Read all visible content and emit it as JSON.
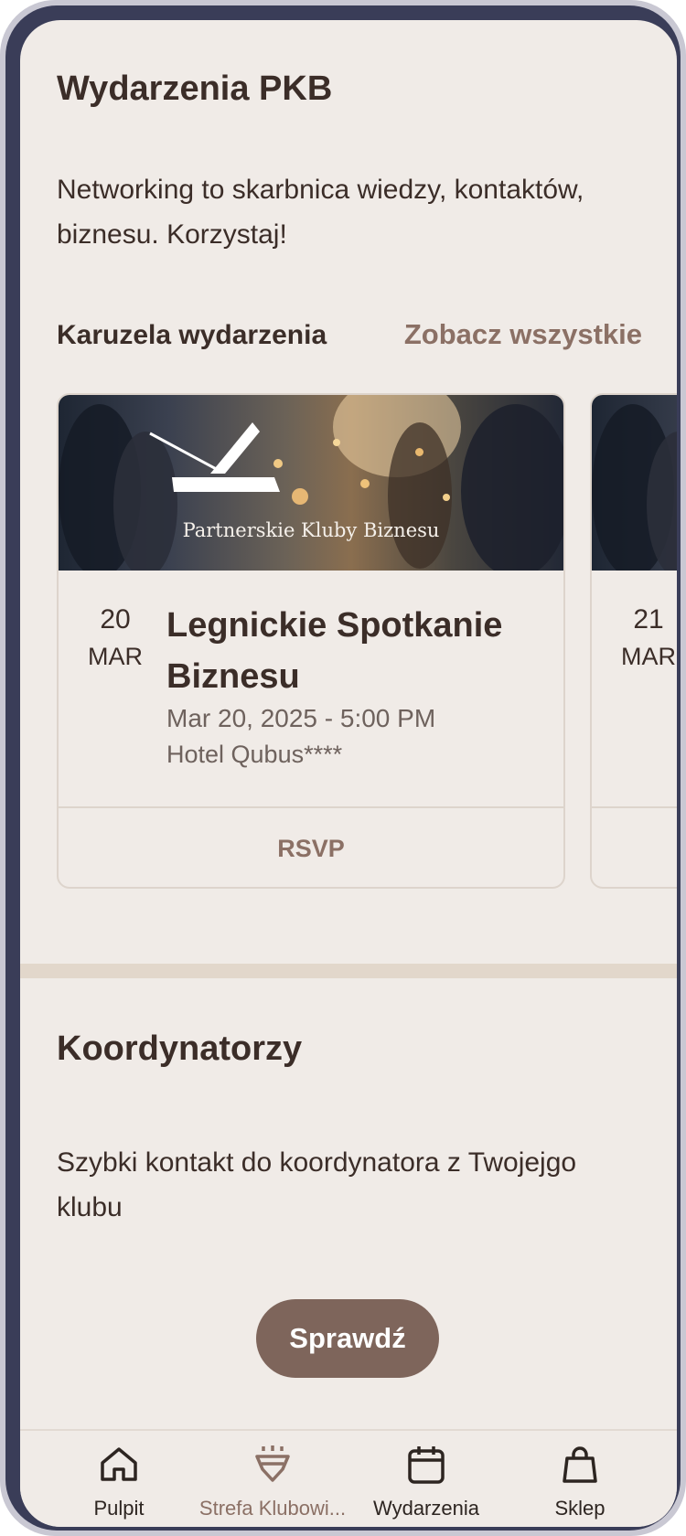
{
  "events_section": {
    "title": "Wydarzenia PKB",
    "description": "Networking to skarbnica wiedzy, kontaktów, biznesu. Korzystaj!",
    "carousel_title": "Karuzela wydarzenia",
    "see_all": "Zobacz wszystkie"
  },
  "events": [
    {
      "image_caption": "Partnerskie Kluby Biznesu",
      "day": "20",
      "month": "MAR",
      "title": "Legnickie Spotkanie Biznesu",
      "datetime": "Mar 20, 2025 - 5:00 PM",
      "location": "Hotel Qubus****",
      "rsvp": "RSVP"
    },
    {
      "day": "21",
      "month": "MAR"
    }
  ],
  "coordinators_section": {
    "title": "Koordynatorzy",
    "description": "Szybki kontakt do koordynatora z Twojejgo klubu",
    "button": "Sprawdź"
  },
  "bottom_nav": [
    {
      "label": "Pulpit",
      "icon": "home-icon",
      "color": "#2d2521"
    },
    {
      "label": "Strefa Klubowi...",
      "icon": "diamond-icon",
      "color": "#8b7065"
    },
    {
      "label": "Wydarzenia",
      "icon": "calendar-icon",
      "color": "#2d2521"
    },
    {
      "label": "Sklep",
      "icon": "shopping-bag-icon",
      "color": "#2d2521"
    }
  ],
  "theme": {
    "background": "#f0ebe7",
    "accent": "#8b7065",
    "button": "#7e655b",
    "text": "#3b2d28",
    "frame": "#3a3d58"
  }
}
